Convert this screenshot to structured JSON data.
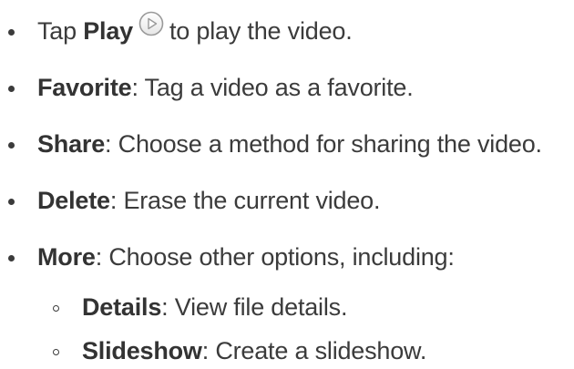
{
  "items": [
    {
      "prefix": "Tap ",
      "bold": "Play",
      "icon": "play-icon",
      "rest": "to play the video."
    },
    {
      "bold": "Favorite",
      "rest": ": Tag a video as a favorite."
    },
    {
      "bold": "Share",
      "rest": ": Choose a method for sharing the video."
    },
    {
      "bold": "Delete",
      "rest": ": Erase the current video."
    },
    {
      "bold": "More",
      "rest": ": Choose other options, including:"
    }
  ],
  "subitems": [
    {
      "bold": "Details",
      "rest": ": View file details."
    },
    {
      "bold": "Slideshow",
      "rest": ": Create a slideshow."
    }
  ],
  "colors": {
    "text": "#3b3b3b",
    "icon_outline": "#9a9a9a"
  }
}
